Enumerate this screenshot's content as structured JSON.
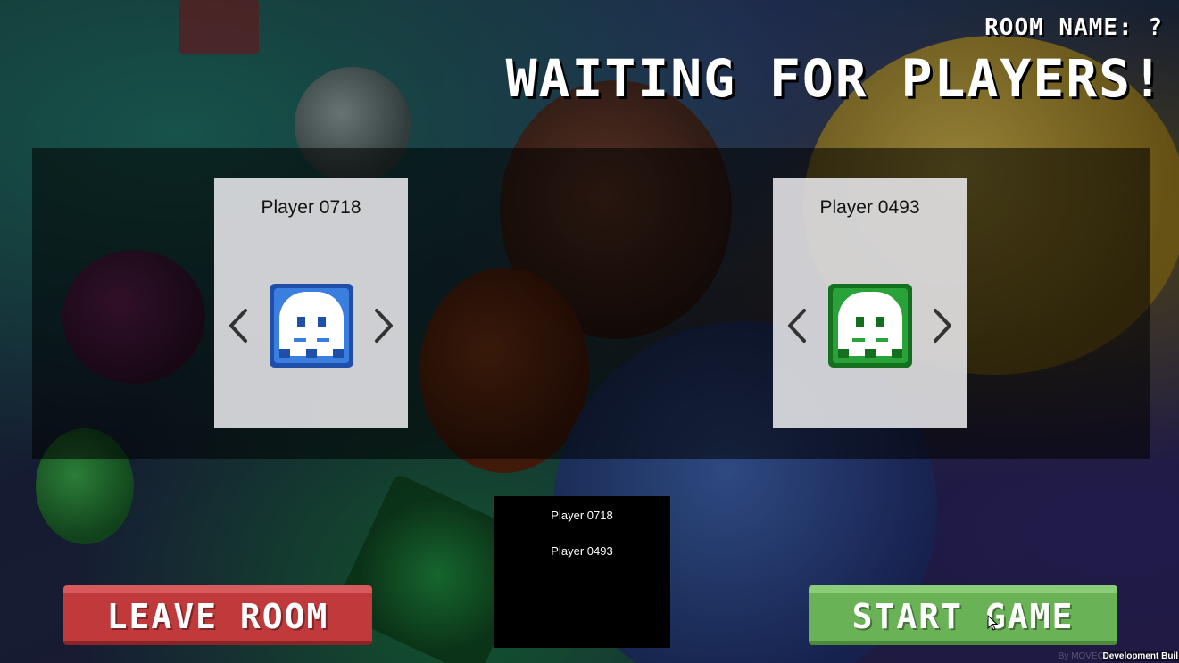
{
  "header": {
    "room_name": "ROOM NAME: ?",
    "title": "WAITING FOR PLAYERS!"
  },
  "players": [
    {
      "name": "Player 0718",
      "avatar_color": "#2e6fd8",
      "avatar_icon": "ghost-icon"
    },
    {
      "name": "Player 0493",
      "avatar_color": "#2aa23a",
      "avatar_icon": "ghost-icon"
    }
  ],
  "buttons": {
    "leave": "LEAVE ROOM",
    "start": "START GAME"
  },
  "player_list": [
    "Player 0718",
    "Player 0493"
  ],
  "footer": {
    "build": "Development Buil",
    "watermark": "By MOVECF"
  },
  "colors": {
    "leave_button": "#c0393b",
    "start_button": "#69b256",
    "panel_bg": "rgba(0,0,0,0.55)"
  }
}
